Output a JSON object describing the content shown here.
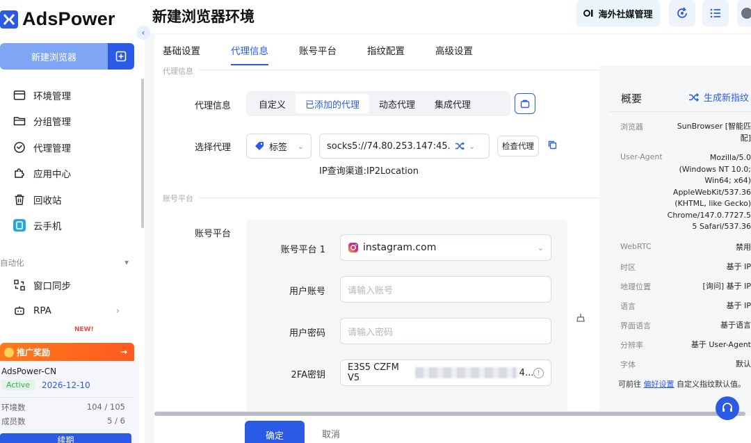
{
  "app": {
    "logo_text": "AdsPower"
  },
  "sidebar": {
    "new_browser_label": "新建浏览器",
    "nav_items": [
      {
        "label": "环境管理",
        "icon": "window-icon"
      },
      {
        "label": "分组管理",
        "icon": "folder-icon"
      },
      {
        "label": "代理管理",
        "icon": "proxy-icon"
      },
      {
        "label": "应用中心",
        "icon": "puzzle-icon"
      },
      {
        "label": "回收站",
        "icon": "trash-icon"
      },
      {
        "label": "云手机",
        "icon": "cloud-phone-icon"
      }
    ],
    "automation_label": "自动化",
    "automation_items": [
      {
        "label": "窗口同步",
        "icon": "sync-icon"
      },
      {
        "label": "RPA",
        "icon": "robot-icon"
      }
    ],
    "new_badge": "NEW!",
    "promo_label": "推广奖励",
    "account": {
      "name": "AdsPower-CN",
      "status": "Active",
      "expiry": "2026-12-10",
      "env_label": "环境数",
      "env_value": "104 / 105",
      "member_label": "成员数",
      "member_value": "5 / 6",
      "renew_label": "续期"
    }
  },
  "header": {
    "title": "新建浏览器环境",
    "social_label": "海外社媒管理"
  },
  "tabs": [
    "基础设置",
    "代理信息",
    "账号平台",
    "指纹配置",
    "高级设置"
  ],
  "proxy_section": {
    "title": "代理信息",
    "proxy_info_label": "代理信息",
    "proxy_types": [
      "自定义",
      "已添加的代理",
      "动态代理",
      "集成代理"
    ],
    "active_type": 1,
    "select_proxy_label": "选择代理",
    "tag_label": "标签",
    "proxy_value": "socks5://74.80.253.147:45...",
    "check_proxy_label": "检查代理",
    "ip_channel": "IP查询渠道:IP2Location"
  },
  "account_section": {
    "title": "账号平台",
    "platform_label": "账号平台",
    "platform1_label": "账号平台 1",
    "platform1_value": "instagram.com",
    "user_label": "用户账号",
    "user_placeholder": "请输入账号",
    "password_label": "用户密码",
    "password_placeholder": "请输入密码",
    "twofa_label": "2FA密钥",
    "twofa_prefix": "E3S5 CZFM V5",
    "twofa_suffix": "4..."
  },
  "overview": {
    "title": "概要",
    "generate_label": "生成新指纹",
    "rows": [
      {
        "label": "浏览器",
        "value": [
          "SunBrowser [智能匹",
          "配]"
        ]
      },
      {
        "label": "User-Agent",
        "value": [
          "Mozilla/5.0",
          "(Windows NT 10.0;",
          "Win64; x64)",
          "AppleWebKit/537.36",
          "(KHTML, like Gecko)",
          "Chrome/147.0.7727.5",
          "5 Safari/537.36"
        ]
      },
      {
        "label": "WebRTC",
        "value": [
          "禁用"
        ]
      },
      {
        "label": "时区",
        "value": [
          "基于 IP"
        ]
      },
      {
        "label": "地理位置",
        "value": [
          "[询问] 基于 IP"
        ]
      },
      {
        "label": "语言",
        "value": [
          "基于 IP"
        ]
      },
      {
        "label": "界面语言",
        "value": [
          "基于语言"
        ]
      },
      {
        "label": "分辨率",
        "value": [
          "基于 User-Agent"
        ]
      },
      {
        "label": "字体",
        "value": [
          "默认"
        ]
      }
    ],
    "footer_prefix": "可前往",
    "footer_link": "偏好设置",
    "footer_suffix": "自定义指纹默认值。"
  },
  "actions": {
    "ok_label": "确定",
    "cancel_label": "取消"
  },
  "colors": {
    "accent": "#2b5be6",
    "promo": "#ff6a1a",
    "active_green": "#3aa55a"
  }
}
